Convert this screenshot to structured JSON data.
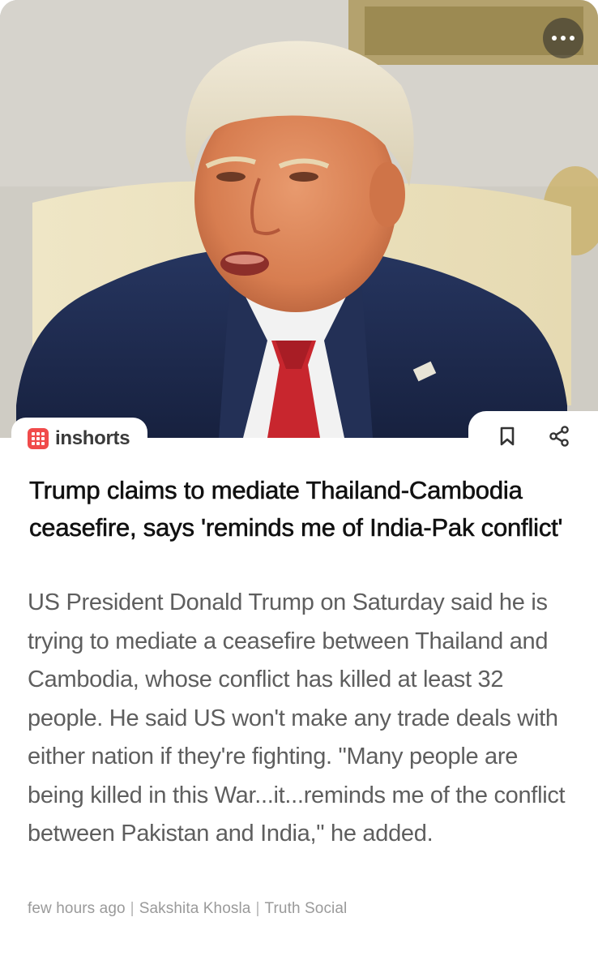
{
  "menu": {
    "icon": "more-horizontal-icon"
  },
  "brand": {
    "name": "inshorts",
    "icon": "inshorts-logo-icon",
    "color": "#f04b4b"
  },
  "actions": {
    "bookmark_icon": "bookmark-icon",
    "share_icon": "share-icon"
  },
  "article": {
    "headline": "Trump claims to mediate Thailand-Cambodia ceasefire, says 'reminds me of India-Pak conflict'",
    "body": "US President Donald Trump on Saturday said he is trying to mediate a ceasefire between Thailand and Cambodia, whose conflict has killed at least 32 people. He said US won't make any trade deals with either nation if they're fighting. \"Many people are being killed in this War...it...reminds me of the conflict between Pakistan and India,\" he added.",
    "time": "few hours ago",
    "author": "Sakshita Khosla",
    "source": "Truth Social",
    "separator": "|"
  },
  "colors": {
    "headline": "#111111",
    "body": "#5e5e5e",
    "meta": "#9a9a9a",
    "suit": "#1f2d55",
    "tie": "#c8262e"
  }
}
